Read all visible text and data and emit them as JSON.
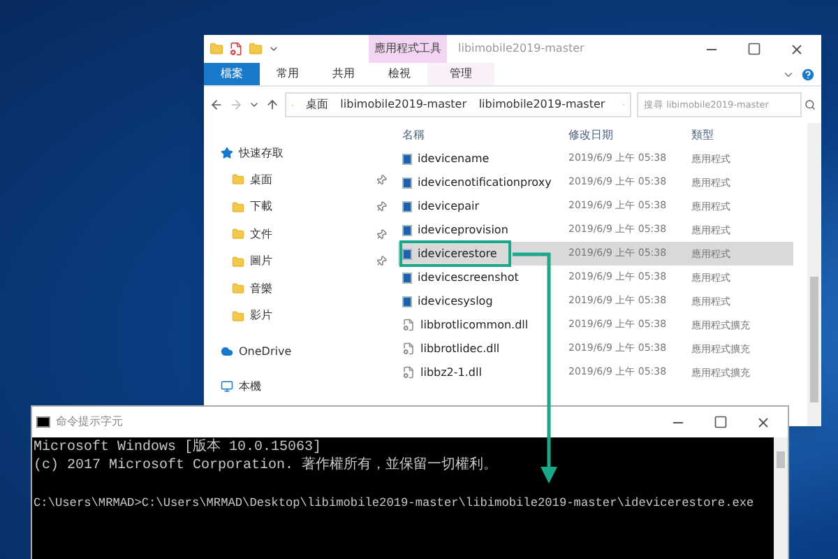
{
  "explorer": {
    "title": "libimobile2019-master",
    "context_tab": "應用程式工具",
    "ribbon_tabs": [
      {
        "label": "檔案",
        "kind": "file"
      },
      {
        "label": "常用",
        "kind": "normal"
      },
      {
        "label": "共用",
        "kind": "normal"
      },
      {
        "label": "檢視",
        "kind": "normal"
      },
      {
        "label": "管理",
        "kind": "context"
      }
    ],
    "breadcrumbs": [
      "桌面",
      "libimobile2019-master",
      "libimobile2019-master"
    ],
    "search": {
      "placeholder": "搜尋 libimobile2019-master"
    },
    "sidebar": [
      {
        "label": "快速存取",
        "kind": "quick_access",
        "children": [
          {
            "label": "桌面",
            "pinned": true
          },
          {
            "label": "下載",
            "pinned": true
          },
          {
            "label": "文件",
            "pinned": true
          },
          {
            "label": "圖片",
            "pinned": true
          },
          {
            "label": "音樂",
            "pinned": false
          },
          {
            "label": "影片",
            "pinned": false
          }
        ]
      },
      {
        "label": "OneDrive",
        "kind": "cloud"
      },
      {
        "label": "本機",
        "kind": "computer"
      }
    ],
    "columns": [
      "名稱",
      "修改日期",
      "類型"
    ],
    "rows": [
      {
        "name": "idevicename",
        "date": "2019/6/9 上午 05:38",
        "type": "應用程式",
        "kind": "exe",
        "selected": false
      },
      {
        "name": "idevicenotificationproxy",
        "date": "2019/6/9 上午 05:38",
        "type": "應用程式",
        "kind": "exe",
        "selected": false
      },
      {
        "name": "idevicepair",
        "date": "2019/6/9 上午 05:38",
        "type": "應用程式",
        "kind": "exe",
        "selected": false
      },
      {
        "name": "ideviceprovision",
        "date": "2019/6/9 上午 05:38",
        "type": "應用程式",
        "kind": "exe",
        "selected": false
      },
      {
        "name": "idevicerestore",
        "date": "2019/6/9 上午 05:38",
        "type": "應用程式",
        "kind": "exe",
        "selected": true
      },
      {
        "name": "idevicescreenshot",
        "date": "2019/6/9 上午 05:38",
        "type": "應用程式",
        "kind": "exe",
        "selected": false
      },
      {
        "name": "idevicesyslog",
        "date": "2019/6/9 上午 05:38",
        "type": "應用程式",
        "kind": "exe",
        "selected": false
      },
      {
        "name": "libbrotlicommon.dll",
        "date": "2019/6/9 上午 05:38",
        "type": "應用程式擴充",
        "kind": "dll",
        "selected": false
      },
      {
        "name": "libbrotlidec.dll",
        "date": "2019/6/9 上午 05:38",
        "type": "應用程式擴充",
        "kind": "dll",
        "selected": false
      },
      {
        "name": "libbz2-1.dll",
        "date": "2019/6/9 上午 05:38",
        "type": "應用程式擴充",
        "kind": "dll",
        "selected": false
      }
    ]
  },
  "console": {
    "title": "命令提示字元",
    "lines": [
      "Microsoft Windows [版本 10.0.15063]",
      "(c) 2017 Microsoft Corporation. 著作權所有，並保留一切權利。",
      "C:\\Users\\MRMAD>C:\\Users\\MRMAD\\Desktop\\libimobile2019-master\\libimobile2019-master\\idevicerestore.exe"
    ]
  }
}
